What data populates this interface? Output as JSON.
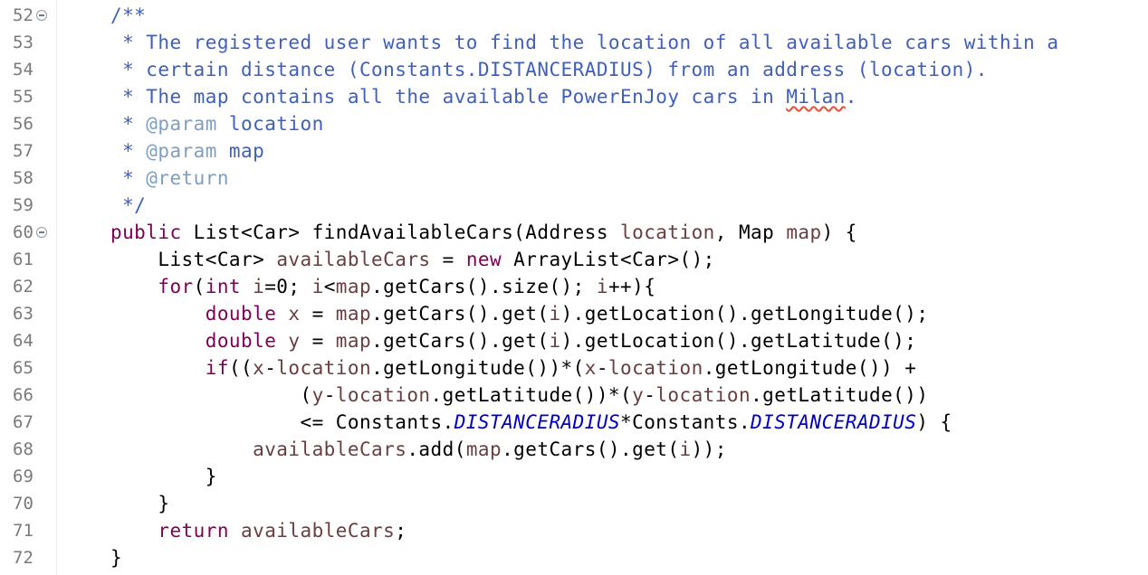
{
  "editor": {
    "lines": [
      {
        "num": "52",
        "fold": true,
        "segs": [
          [
            "c",
            "/**"
          ]
        ]
      },
      {
        "num": "53",
        "fold": false,
        "segs": [
          [
            "c",
            " * The registered user wants to find the location of all available cars within a"
          ]
        ]
      },
      {
        "num": "54",
        "fold": false,
        "segs": [
          [
            "c",
            " * certain distance (Constants.DISTANCERADIUS) from an address (location)."
          ]
        ]
      },
      {
        "num": "55",
        "fold": false,
        "segs": [
          [
            "c",
            " * The map contains all the available PowerEnJoy cars in "
          ],
          [
            "c spell",
            "Milan"
          ],
          [
            "c",
            "."
          ]
        ]
      },
      {
        "num": "56",
        "fold": false,
        "segs": [
          [
            "c",
            " * "
          ],
          [
            "tag",
            "@param"
          ],
          [
            "c",
            " location"
          ]
        ]
      },
      {
        "num": "57",
        "fold": false,
        "segs": [
          [
            "c",
            " * "
          ],
          [
            "tag",
            "@param"
          ],
          [
            "c",
            " map"
          ]
        ]
      },
      {
        "num": "58",
        "fold": false,
        "segs": [
          [
            "c",
            " * "
          ],
          [
            "tag",
            "@return"
          ]
        ]
      },
      {
        "num": "59",
        "fold": false,
        "segs": [
          [
            "c",
            " */"
          ]
        ]
      },
      {
        "num": "60",
        "fold": true,
        "segs": [
          [
            "kw",
            "public"
          ],
          [
            "",
            " List<Car> findAvailableCars(Address "
          ],
          [
            "v",
            "location"
          ],
          [
            "",
            ", Map "
          ],
          [
            "v",
            "map"
          ],
          [
            "",
            ") {"
          ]
        ]
      },
      {
        "num": "61",
        "fold": false,
        "segs": [
          [
            "",
            "    List<Car> "
          ],
          [
            "v",
            "availableCars"
          ],
          [
            "",
            " = "
          ],
          [
            "kw",
            "new"
          ],
          [
            "",
            " ArrayList<Car>();"
          ]
        ]
      },
      {
        "num": "62",
        "fold": false,
        "segs": [
          [
            "",
            "    "
          ],
          [
            "kw",
            "for"
          ],
          [
            "",
            "("
          ],
          [
            "kw",
            "int"
          ],
          [
            "",
            " "
          ],
          [
            "v",
            "i"
          ],
          [
            "",
            "=0; "
          ],
          [
            "v",
            "i"
          ],
          [
            "",
            "<"
          ],
          [
            "v",
            "map"
          ],
          [
            "",
            ".getCars().size(); "
          ],
          [
            "v",
            "i"
          ],
          [
            "",
            "++){"
          ]
        ]
      },
      {
        "num": "63",
        "fold": false,
        "segs": [
          [
            "",
            "        "
          ],
          [
            "kw",
            "double"
          ],
          [
            "",
            " "
          ],
          [
            "v",
            "x"
          ],
          [
            "",
            " = "
          ],
          [
            "v",
            "map"
          ],
          [
            "",
            ".getCars().get("
          ],
          [
            "v",
            "i"
          ],
          [
            "",
            ").getLocation().getLongitude();"
          ]
        ]
      },
      {
        "num": "64",
        "fold": false,
        "segs": [
          [
            "",
            "        "
          ],
          [
            "kw",
            "double"
          ],
          [
            "",
            " "
          ],
          [
            "v",
            "y"
          ],
          [
            "",
            " = "
          ],
          [
            "v",
            "map"
          ],
          [
            "",
            ".getCars().get("
          ],
          [
            "v",
            "i"
          ],
          [
            "",
            ").getLocation().getLatitude();"
          ]
        ]
      },
      {
        "num": "65",
        "fold": false,
        "segs": [
          [
            "",
            "        "
          ],
          [
            "kw",
            "if"
          ],
          [
            "",
            "(("
          ],
          [
            "v",
            "x"
          ],
          [
            "",
            "-"
          ],
          [
            "v",
            "location"
          ],
          [
            "",
            ".getLongitude())*("
          ],
          [
            "v",
            "x"
          ],
          [
            "",
            "-"
          ],
          [
            "v",
            "location"
          ],
          [
            "",
            ".getLongitude()) +"
          ]
        ]
      },
      {
        "num": "66",
        "fold": false,
        "segs": [
          [
            "",
            "                ("
          ],
          [
            "v",
            "y"
          ],
          [
            "",
            "-"
          ],
          [
            "v",
            "location"
          ],
          [
            "",
            ".getLatitude())*("
          ],
          [
            "v",
            "y"
          ],
          [
            "",
            "-"
          ],
          [
            "v",
            "location"
          ],
          [
            "",
            ".getLatitude())"
          ]
        ]
      },
      {
        "num": "67",
        "fold": false,
        "segs": [
          [
            "",
            "                <= Constants."
          ],
          [
            "st",
            "DISTANCERADIUS"
          ],
          [
            "",
            "*Constants."
          ],
          [
            "st",
            "DISTANCERADIUS"
          ],
          [
            "",
            ") {"
          ]
        ]
      },
      {
        "num": "68",
        "fold": false,
        "segs": [
          [
            "",
            "            "
          ],
          [
            "v",
            "availableCars"
          ],
          [
            "",
            ".add("
          ],
          [
            "v",
            "map"
          ],
          [
            "",
            ".getCars().get("
          ],
          [
            "v",
            "i"
          ],
          [
            "",
            "));"
          ]
        ]
      },
      {
        "num": "69",
        "fold": false,
        "segs": [
          [
            "",
            "        }"
          ]
        ]
      },
      {
        "num": "70",
        "fold": false,
        "segs": [
          [
            "",
            "    }"
          ]
        ]
      },
      {
        "num": "71",
        "fold": false,
        "segs": [
          [
            "",
            "    "
          ],
          [
            "kw",
            "return"
          ],
          [
            "",
            " "
          ],
          [
            "v",
            "availableCars"
          ],
          [
            "",
            ";"
          ]
        ]
      },
      {
        "num": "72",
        "fold": false,
        "segs": [
          [
            "",
            "}"
          ]
        ]
      }
    ]
  }
}
